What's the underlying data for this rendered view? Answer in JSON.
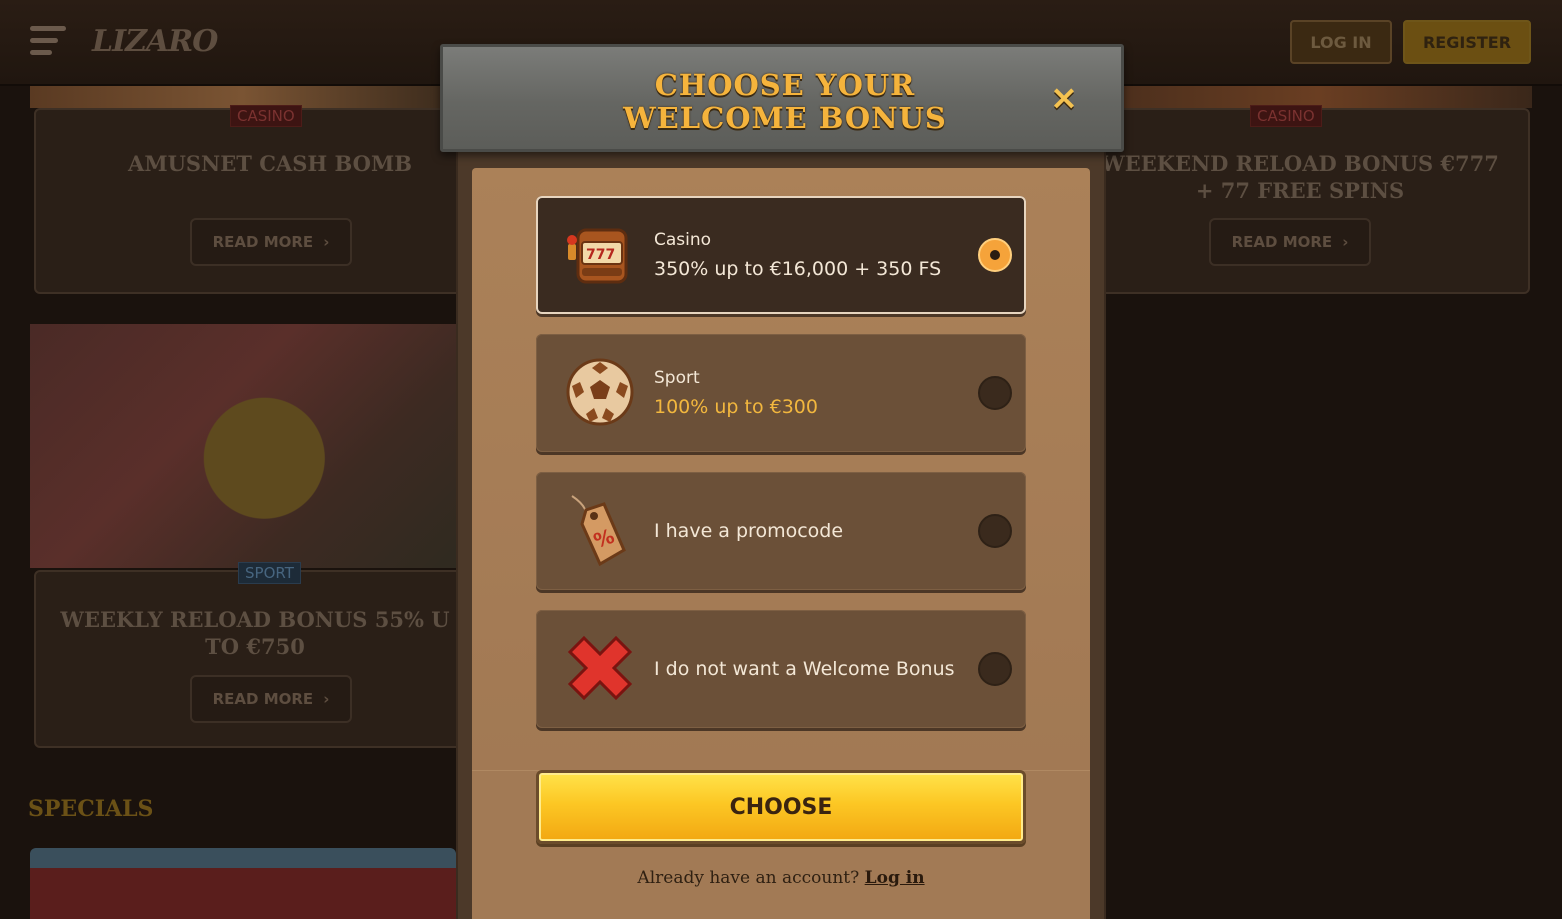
{
  "header": {
    "logo_text": "LIZARO",
    "login_label": "LOG IN",
    "register_label": "REGISTER"
  },
  "background_cards": [
    {
      "tag": "CASINO",
      "title": "AMUSNET CASH BOMB",
      "button": "READ MORE"
    },
    {
      "tag": "CASINO",
      "title": "WEEKEND RELOAD BONUS €777\n+ 77 FREE SPINS",
      "button": "READ MORE"
    },
    {
      "tag": "SPORT",
      "title": "WEEKLY RELOAD BONUS 55% U\nTO €750",
      "button": "READ MORE"
    }
  ],
  "specials_heading": "SPECIALS",
  "modal": {
    "title": "CHOOSE YOUR\nWELCOME BONUS",
    "close_icon": "×",
    "options": [
      {
        "icon": "slot-machine-icon",
        "title": "Casino",
        "subtitle": "350% up to €16,000 + 350 FS",
        "selected": true
      },
      {
        "icon": "soccer-ball-icon",
        "title": "Sport",
        "subtitle": "100% up to €300",
        "selected": false
      },
      {
        "icon": "promo-tag-icon",
        "label": "I have a promocode",
        "selected": false
      },
      {
        "icon": "red-x-icon",
        "label": "I do not want a Welcome Bonus",
        "selected": false
      }
    ],
    "choose_label": "CHOOSE",
    "account_prompt": "Already have an account?",
    "login_link": "Log in"
  },
  "colors": {
    "accent_gold": "#f6b43c",
    "choose_button": "#fcc724",
    "selected_radio": "#f5a33a"
  }
}
